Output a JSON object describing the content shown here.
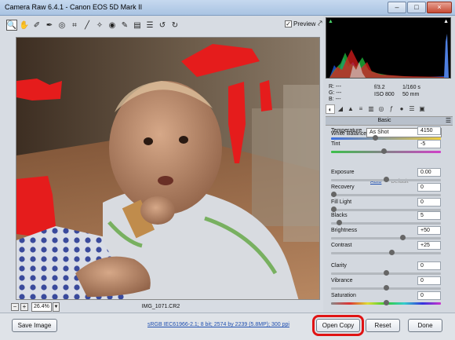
{
  "window": {
    "title": "Camera Raw 6.4.1  -  Canon EOS 5D Mark II"
  },
  "window_buttons": {
    "minimize": "–",
    "maximize": "□",
    "close": "×"
  },
  "toolbar": {
    "tool_icons": [
      "zoom-tool-icon",
      "hand-tool-icon",
      "white-balance-tool-icon",
      "color-sampler-tool-icon",
      "targeted-adjustment-tool-icon",
      "crop-tool-icon",
      "straighten-tool-icon",
      "spot-removal-tool-icon",
      "red-eye-tool-icon",
      "adjustment-brush-icon",
      "graduated-filter-icon",
      "preferences-icon",
      "rotate-ccw-icon",
      "rotate-cw-icon"
    ],
    "preview_label": "Preview",
    "preview_checked": true
  },
  "status": {
    "zoom": "26.4%",
    "filename": "IMG_1071.CR2"
  },
  "readout": {
    "r_label": "R:",
    "r_value": "---",
    "g_label": "G:",
    "g_value": "---",
    "b_label": "B:",
    "b_value": "---",
    "aperture": "f/3.2",
    "shutter": "1/160 s",
    "iso": "ISO 800",
    "focal": "50 mm"
  },
  "panel": {
    "title": "Basic"
  },
  "white_balance": {
    "label": "White Balance:",
    "value": "As Shot"
  },
  "sliders": [
    {
      "label": "Temperature",
      "value": "4150",
      "pos": 0.4
    },
    {
      "label": "Tint",
      "value": "-5",
      "pos": 0.48
    },
    {
      "label": "Exposure",
      "value": "0.00",
      "pos": 0.5
    },
    {
      "label": "Recovery",
      "value": "0",
      "pos": 0.0
    },
    {
      "label": "Fill Light",
      "value": "0",
      "pos": 0.0
    },
    {
      "label": "Blacks",
      "value": "5",
      "pos": 0.05
    },
    {
      "label": "Brightness",
      "value": "+50",
      "pos": 0.66
    },
    {
      "label": "Contrast",
      "value": "+25",
      "pos": 0.56
    },
    {
      "label": "Clarity",
      "value": "0",
      "pos": 0.5
    },
    {
      "label": "Vibrance",
      "value": "0",
      "pos": 0.5
    },
    {
      "label": "Saturation",
      "value": "0",
      "pos": 0.5
    }
  ],
  "auto_label": "Auto",
  "default_label": "Default",
  "bottom": {
    "save": "Save Image",
    "workflow": "sRGB IEC61966-2.1; 8 bit; 2574 by 2239 (5.8MP); 300 ppi",
    "open": "Open Copy",
    "reset": "Reset",
    "done": "Done"
  }
}
